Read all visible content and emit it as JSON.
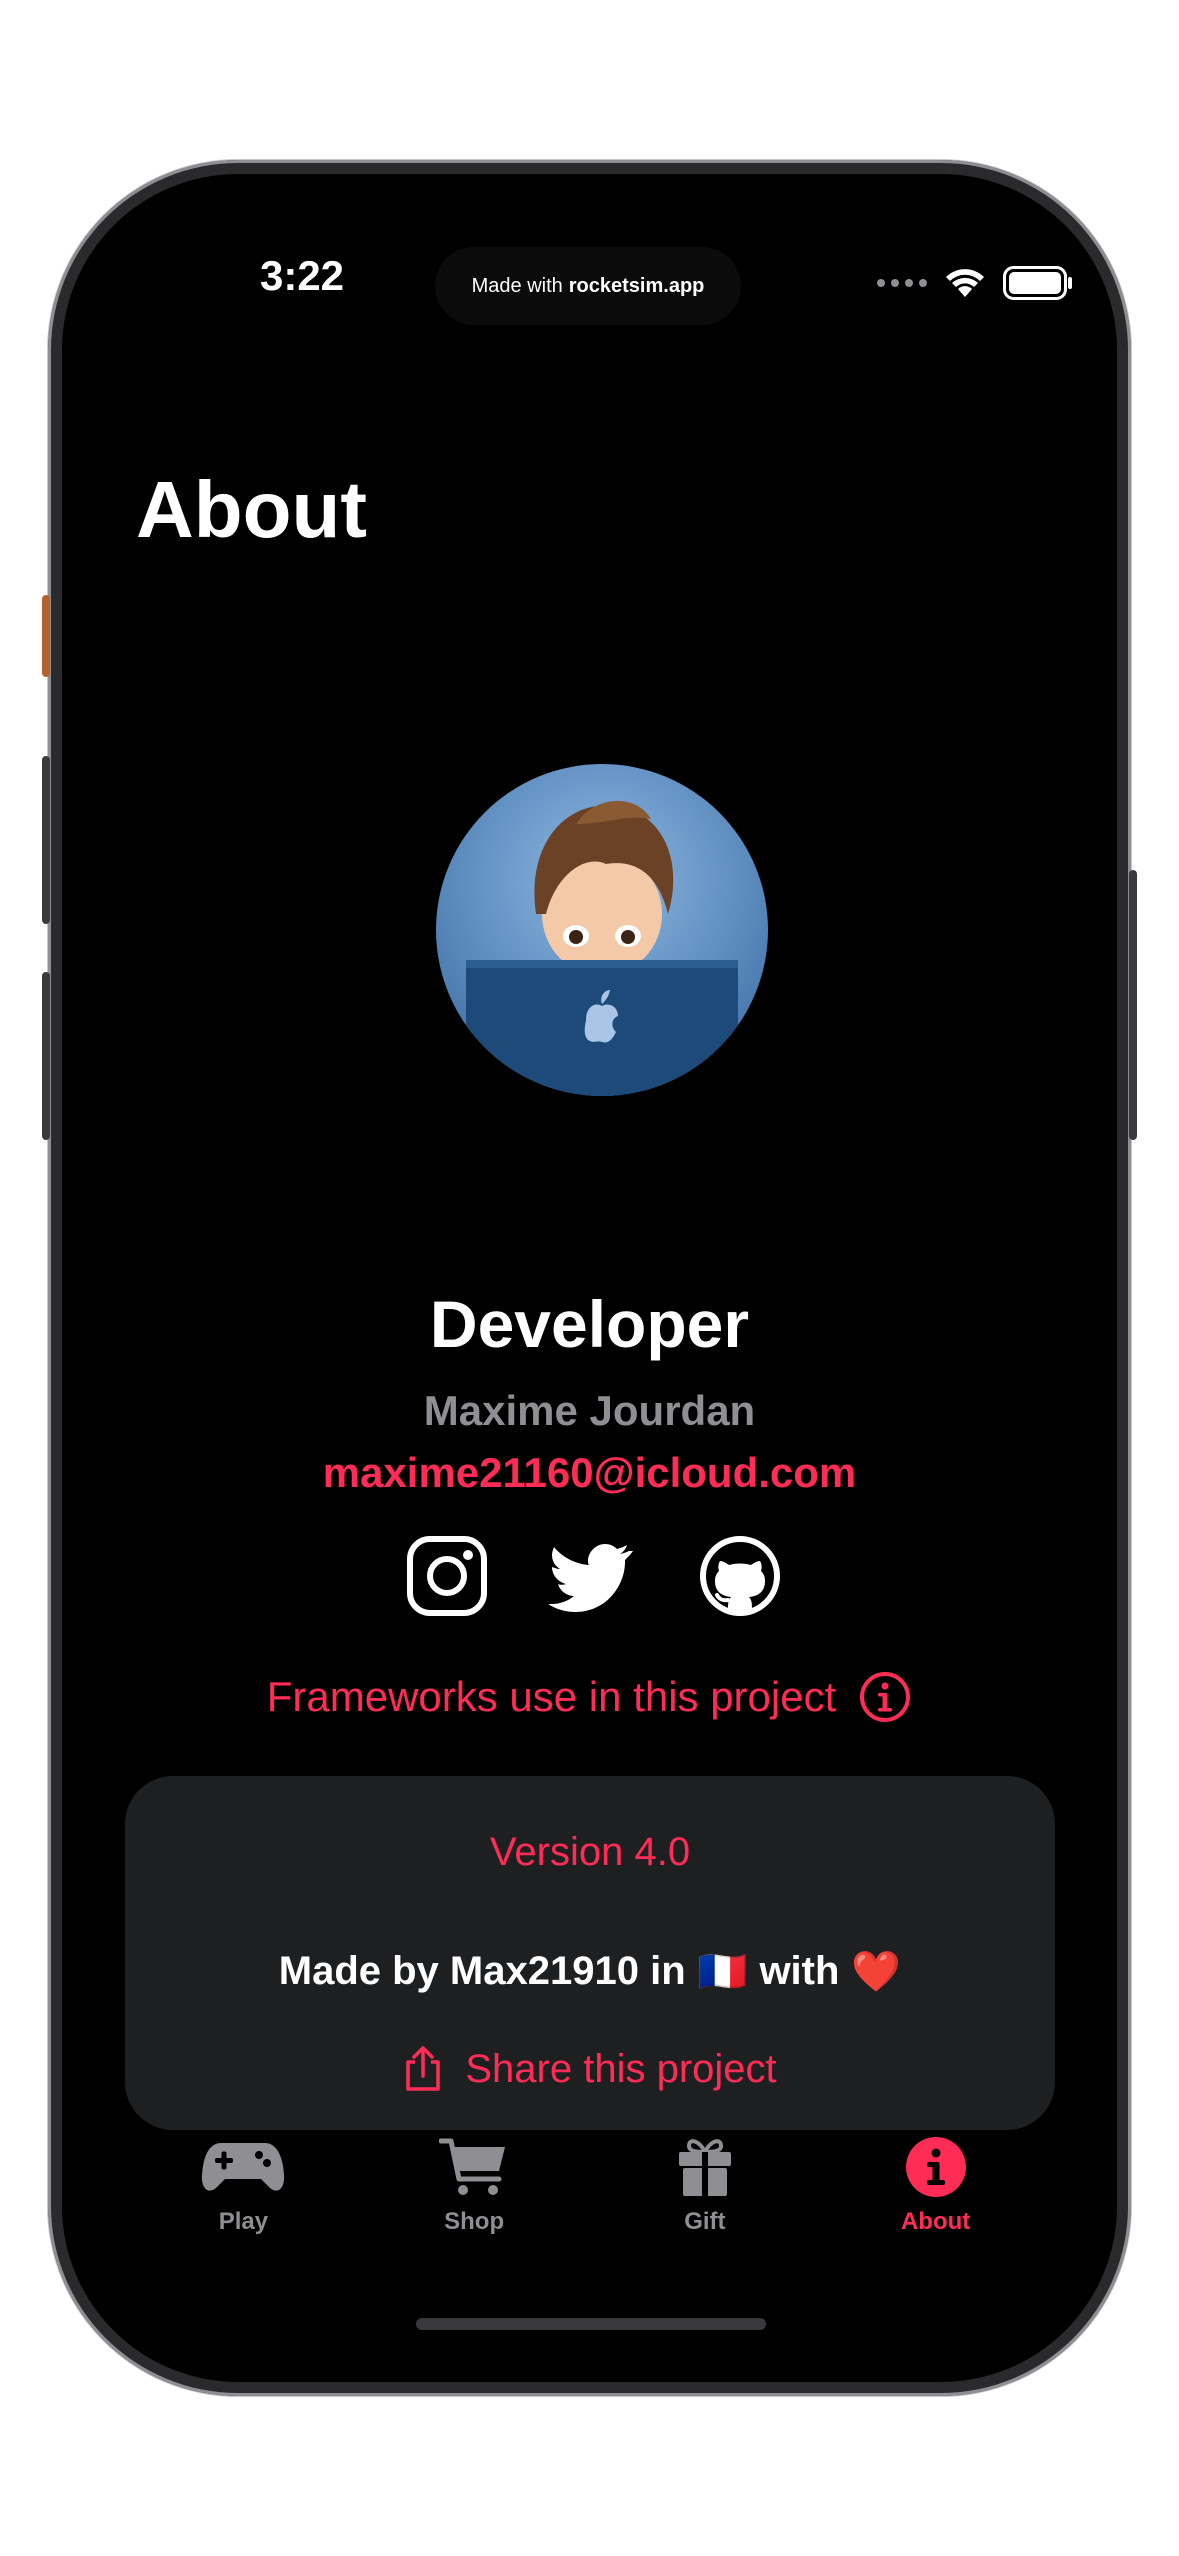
{
  "status_bar": {
    "time": "3:22",
    "island_prefix": "Made with",
    "island_brand": "rocketsim.app"
  },
  "nav": {
    "title": "About"
  },
  "developer": {
    "title": "Developer",
    "name": "Maxime Jourdan",
    "email": "maxime21160@icloud.com"
  },
  "social": [
    "instagram-icon",
    "twitter-icon",
    "github-icon"
  ],
  "frameworks": {
    "label": "Frameworks use in this project"
  },
  "card": {
    "version": "Version 4.0",
    "made_by_prefix": "Made by Max21910 in",
    "made_by_flag": "🇫🇷",
    "made_by_with": "with",
    "made_by_heart": "❤️",
    "share_label": "Share this project"
  },
  "tabs": [
    {
      "label": "Play",
      "icon": "gamecontroller-icon",
      "active": false
    },
    {
      "label": "Shop",
      "icon": "cart-icon",
      "active": false
    },
    {
      "label": "Gift",
      "icon": "gift-icon",
      "active": false
    },
    {
      "label": "About",
      "icon": "info-icon",
      "active": true
    }
  ],
  "colors": {
    "accent": "#ff2d55",
    "background": "#000000",
    "card": "#1e1f21",
    "secondary_text": "#8e8e93"
  }
}
